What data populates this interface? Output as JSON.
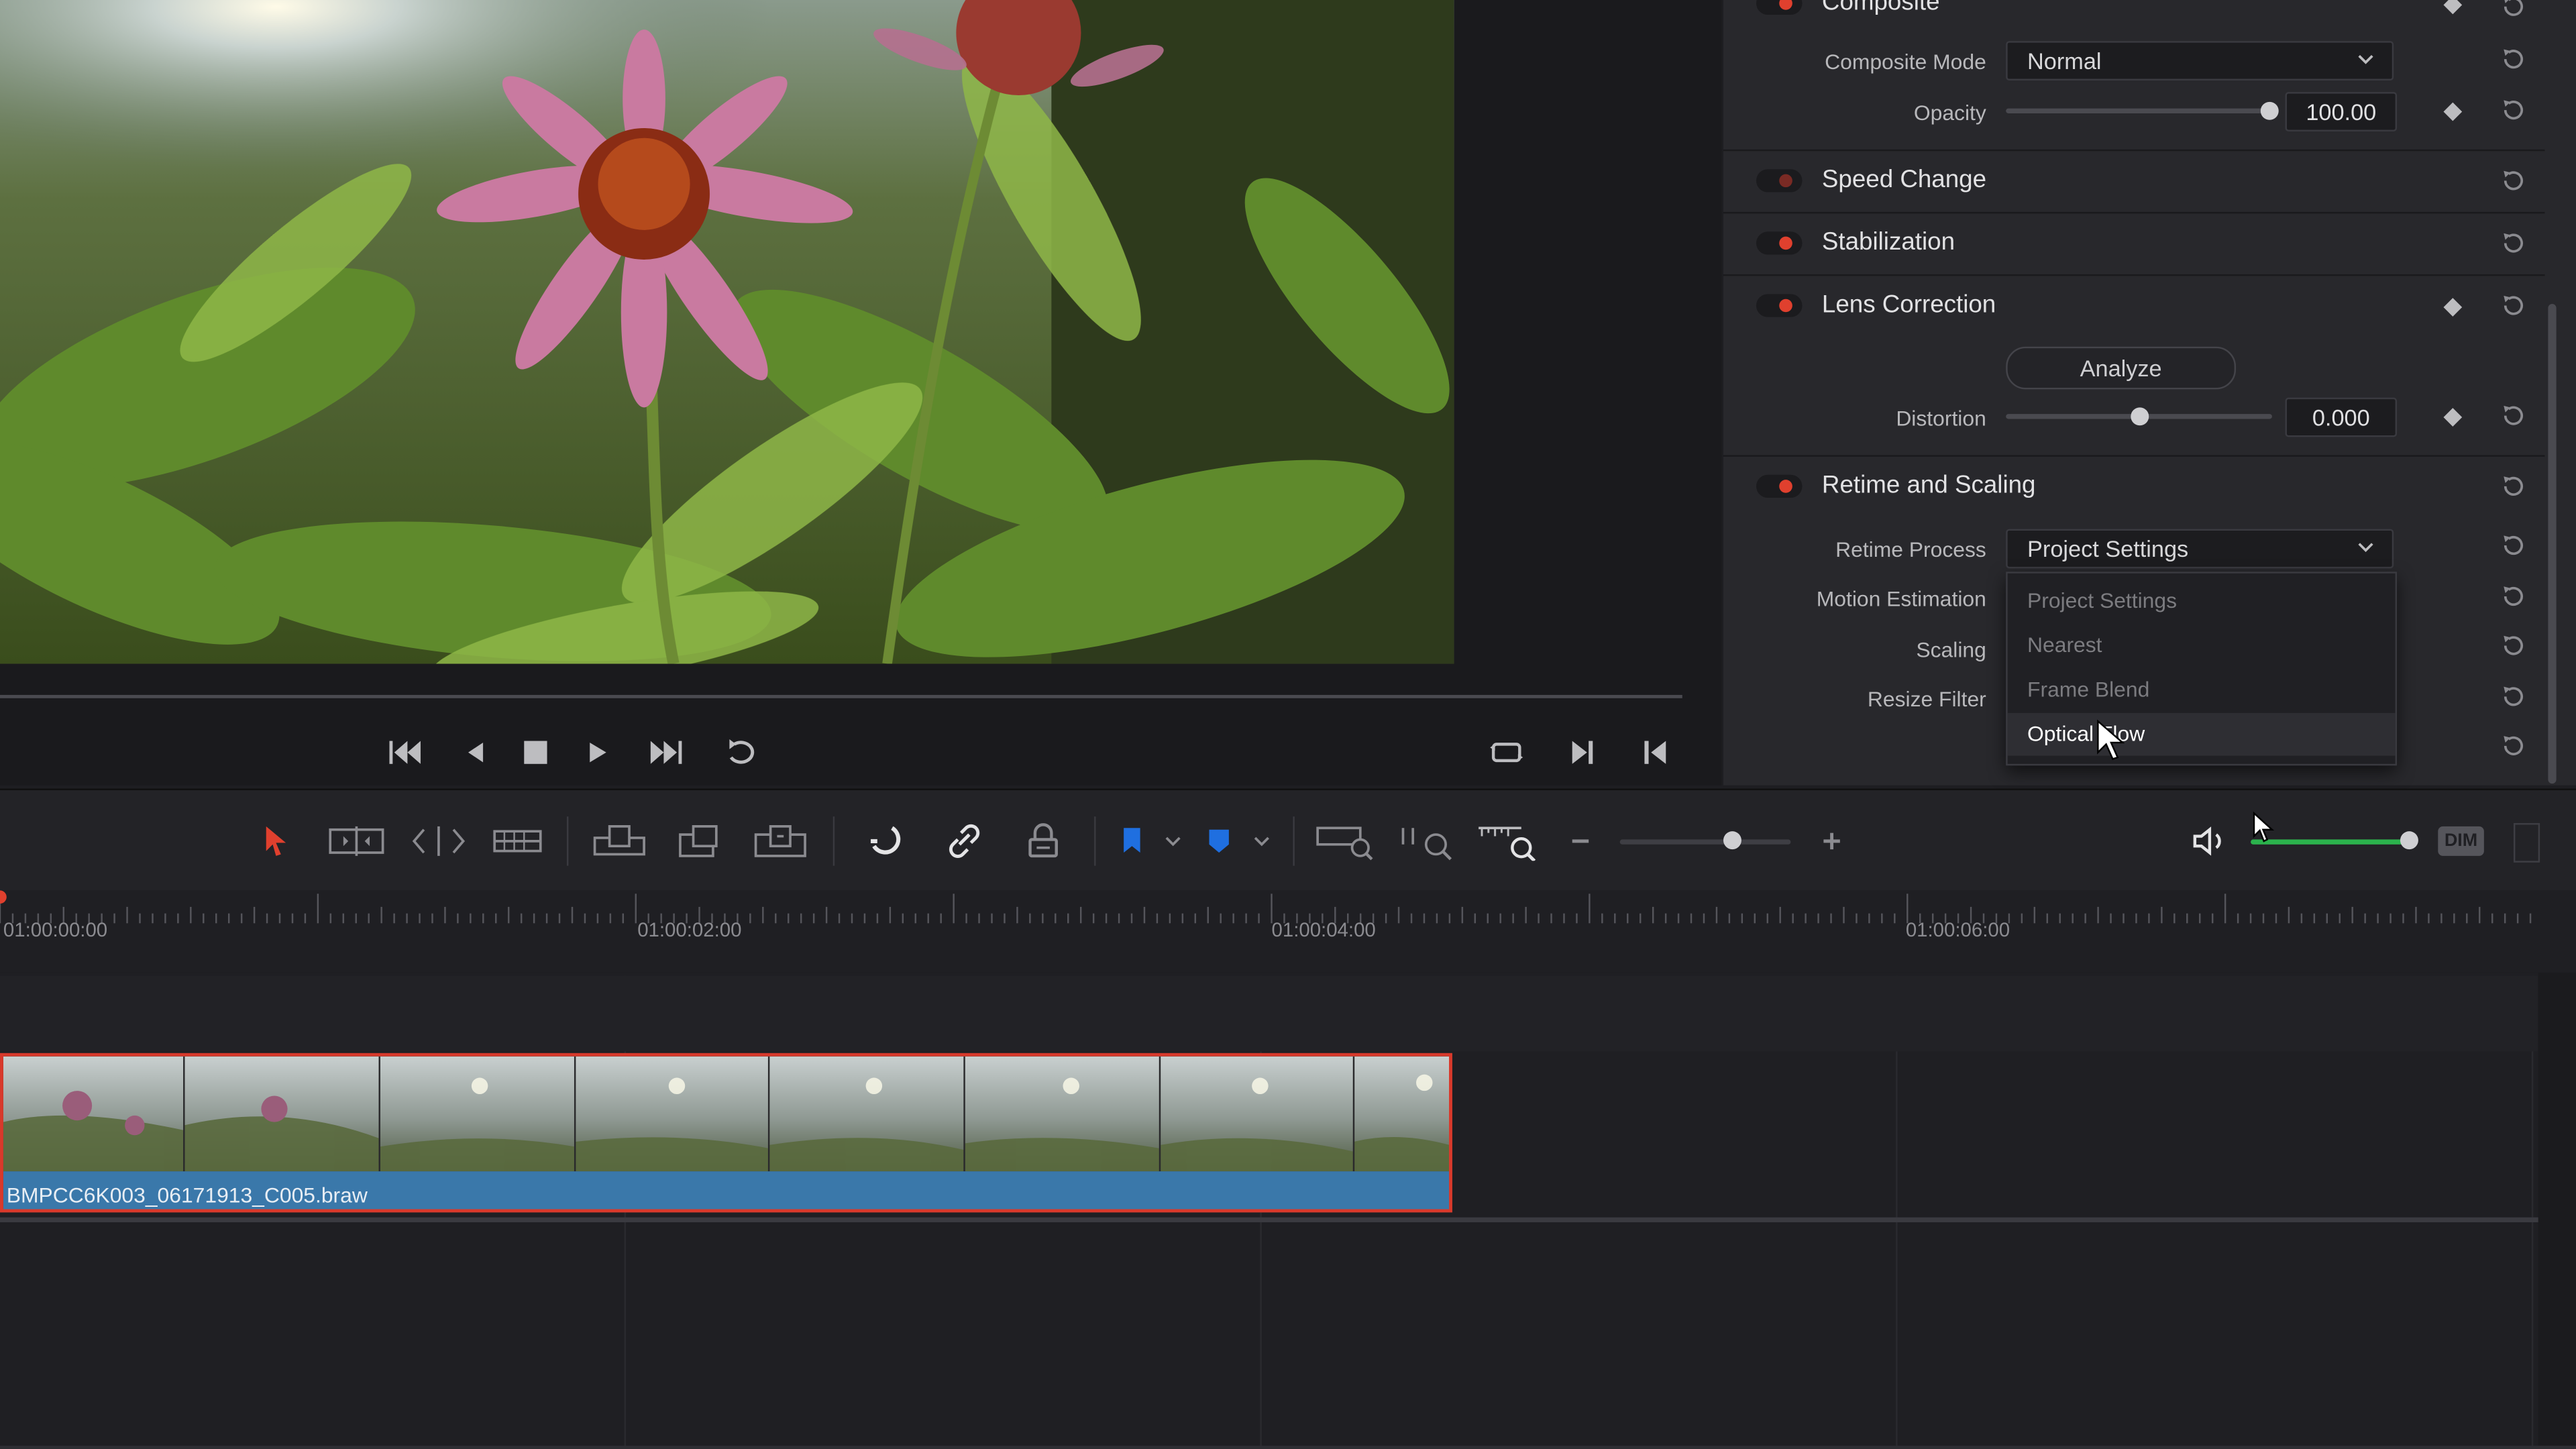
{
  "inspector": {
    "composite": {
      "title": "Composite",
      "mode_label": "Composite Mode",
      "mode_value": "Normal",
      "opacity_label": "Opacity",
      "opacity_value": "100.00",
      "opacity_level": 1.0
    },
    "speed_change": {
      "title": "Speed Change"
    },
    "stabilization": {
      "title": "Stabilization"
    },
    "lens_correction": {
      "title": "Lens Correction",
      "analyze_label": "Analyze",
      "distortion_label": "Distortion",
      "distortion_value": "0.000",
      "distortion_level": 0.5
    },
    "retime": {
      "title": "Retime and Scaling",
      "process_label": "Retime Process",
      "process_value": "Project Settings",
      "motion_label": "Motion Estimation",
      "scaling_label": "Scaling",
      "resize_label": "Resize Filter",
      "menu_options": [
        "Project Settings",
        "Nearest",
        "Frame Blend",
        "Optical Flow"
      ],
      "menu_highlighted": "Optical Flow"
    }
  },
  "toolbar": {
    "dim_label": "DIM",
    "volume_level": 1.0,
    "zoom_level": 0.65
  },
  "timeline": {
    "timecodes": [
      "01:00:00:00",
      "01:00:02:00",
      "01:00:04:00",
      "01:00:06:00"
    ],
    "clip_name": "BMPCC6K003_06171913_C005.braw"
  },
  "colors": {
    "accent_red": "#e0402e",
    "clip_blue": "#3a78aa",
    "volume_green": "#2bb24c",
    "flag_blue": "#1f6fe0"
  }
}
